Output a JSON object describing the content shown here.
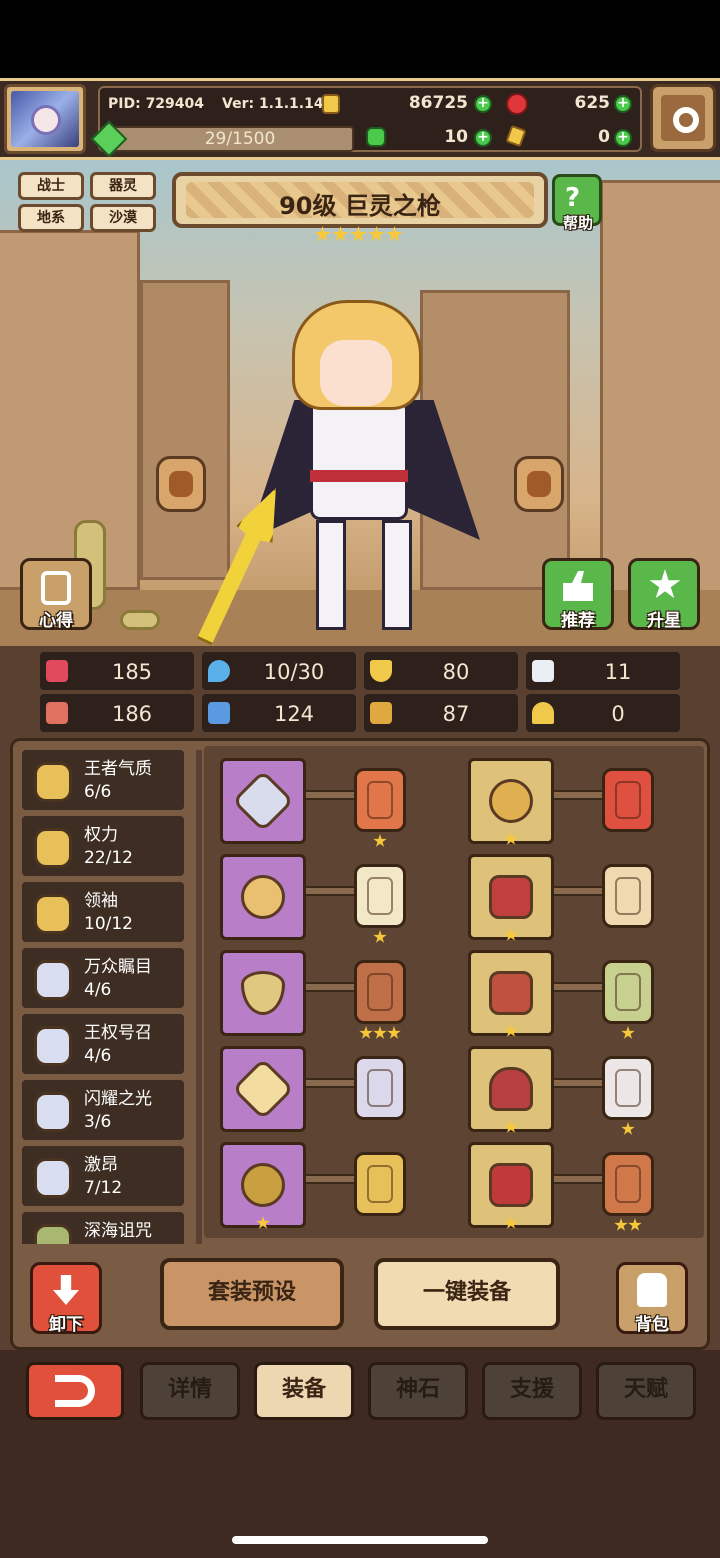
{
  "header": {
    "pid": "PID: 729404",
    "version": "Ver: 1.1.1.14",
    "gold": "86725",
    "ruby": "625",
    "energy": "29/1500",
    "clover": "10",
    "keys": "0"
  },
  "hero": {
    "tags": [
      "战士",
      "器灵",
      "地系",
      "沙漠"
    ],
    "title": "90级  巨灵之枪",
    "stars": 5,
    "help_label": "帮助",
    "notes_label": "心得",
    "recommend_label": "推荐",
    "starup_label": "升星"
  },
  "stats": [
    {
      "icon": "heart-icon",
      "value": "185"
    },
    {
      "icon": "water-drop-icon",
      "value": "10/30"
    },
    {
      "icon": "shield-icon",
      "value": "80"
    },
    {
      "icon": "wing-icon",
      "value": "11"
    },
    {
      "icon": "fist-icon",
      "value": "186"
    },
    {
      "icon": "book-icon",
      "value": "124"
    },
    {
      "icon": "boot-icon",
      "value": "87"
    },
    {
      "icon": "horseshoe-icon",
      "value": "0"
    }
  ],
  "sets": [
    {
      "name": "王者气质",
      "progress": "6/6",
      "tier": "gold"
    },
    {
      "name": "权力",
      "progress": "22/12",
      "tier": "gold"
    },
    {
      "name": "领袖",
      "progress": "10/12",
      "tier": "gold"
    },
    {
      "name": "万众瞩目",
      "progress": "4/6",
      "tier": "silver"
    },
    {
      "name": "王权号召",
      "progress": "4/6",
      "tier": "silver"
    },
    {
      "name": "闪耀之光",
      "progress": "3/6",
      "tier": "silver"
    },
    {
      "name": "激昂",
      "progress": "7/12",
      "tier": "silver"
    },
    {
      "name": "深海诅咒",
      "progress": "",
      "tier": "green"
    }
  ],
  "equipment": {
    "left": [
      {
        "item": "sword-icon",
        "rune_stars": 1
      },
      {
        "item": "compass-icon",
        "rune_stars": 1
      },
      {
        "item": "necklace-icon",
        "rune_stars": 3
      },
      {
        "item": "gem-icon",
        "rune_stars": 0
      },
      {
        "item": "ring-icon",
        "rune_stars": 0
      }
    ],
    "right": [
      {
        "item": "crown-icon",
        "rune_stars": 0
      },
      {
        "item": "armor-icon",
        "rune_stars": 0
      },
      {
        "item": "gauntlet-icon",
        "rune_stars": 1
      },
      {
        "item": "belt-icon",
        "rune_stars": 1
      },
      {
        "item": "boots-icon",
        "rune_stars": 2
      }
    ]
  },
  "actions": {
    "unequip_label": "卸下",
    "preset_label": "套装预设",
    "auto_equip_label": "一键装备",
    "bag_label": "背包"
  },
  "tabs": [
    {
      "label": "详情",
      "active": false
    },
    {
      "label": "装备",
      "active": true
    },
    {
      "label": "神石",
      "active": false
    },
    {
      "label": "支援",
      "active": false
    },
    {
      "label": "天赋",
      "active": false
    }
  ],
  "colors": {
    "panel_dark": "#2e211b",
    "panel_brown": "#7a5c44",
    "accent_gold": "#f6c83a",
    "accent_red": "#e0503a",
    "accent_green": "#4ac94a"
  }
}
